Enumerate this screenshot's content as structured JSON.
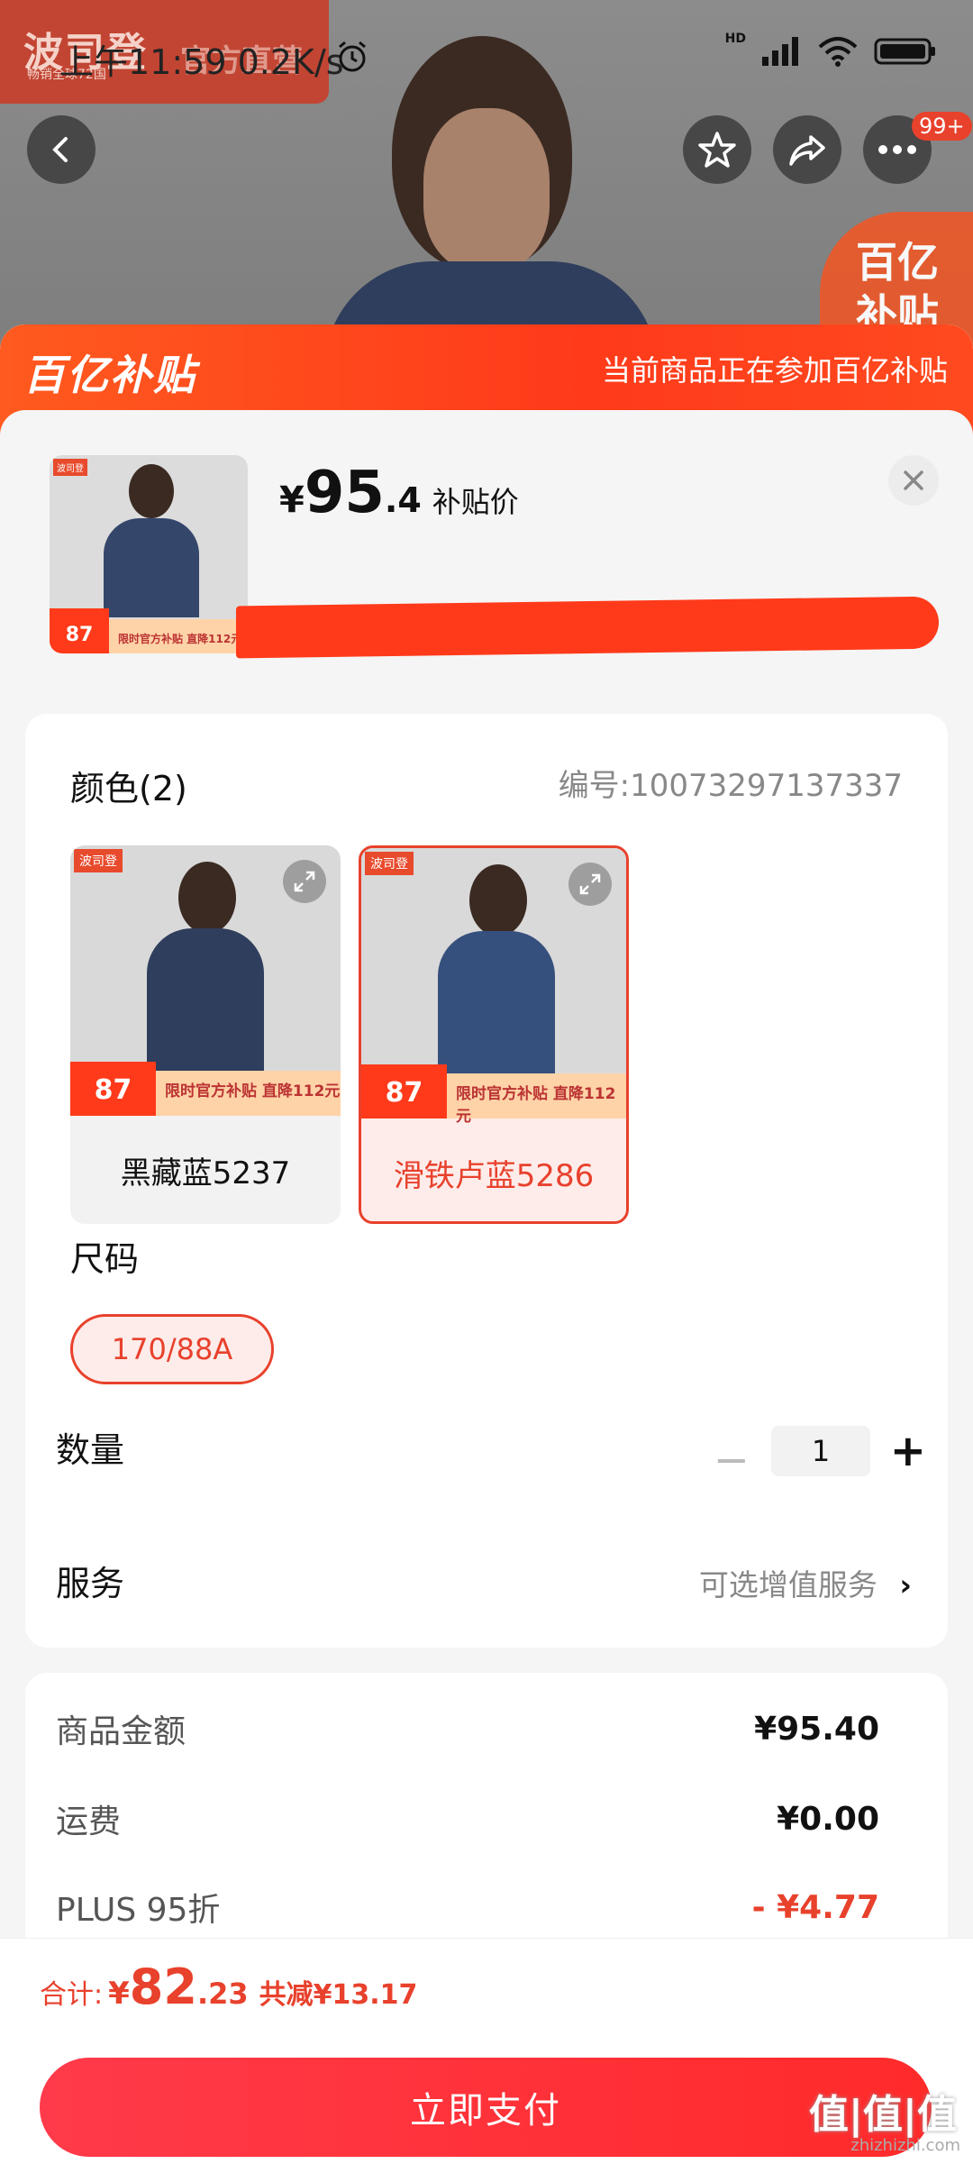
{
  "status_bar": {
    "time": "上午11:59",
    "speed": "0.2K/s",
    "hd": "HD"
  },
  "store": {
    "name": "波司登",
    "sub": "畅销全球72国",
    "official": "官方直营"
  },
  "header": {
    "cart_badge": "99+",
    "corner_tag_line1": "百亿",
    "corner_tag_line2": "补贴"
  },
  "banner": {
    "logo": "百亿补贴",
    "note": "当前商品正在参加百亿补贴"
  },
  "product": {
    "price_yen": "¥",
    "price_int": "95",
    "price_dec": ".4",
    "price_label": "补贴价",
    "thumb_price": "87",
    "thumb_promo": "限时官方补贴 直降112元"
  },
  "options": {
    "color_title": "颜色(2)",
    "serial": "编号:10073297137337",
    "colors": [
      {
        "label": "黑藏蓝5237",
        "price": "87",
        "promo": "限时官方补贴 直降112元",
        "selected": false
      },
      {
        "label": "滑铁卢蓝5286",
        "price": "87",
        "promo": "限时官方补贴 直降112元",
        "selected": true
      }
    ],
    "size_title": "尺码",
    "size_selected": "170/88A",
    "qty_title": "数量",
    "qty_value": "1",
    "service_title": "服务",
    "service_value": "可选增值服务"
  },
  "fees": [
    {
      "label": "商品金额",
      "value": "¥95.40"
    },
    {
      "label": "运费",
      "value": "¥0.00"
    },
    {
      "label": "PLUS 95折",
      "value": "- ¥4.77"
    }
  ],
  "footer": {
    "total_label": "合计:",
    "total_yen": "¥",
    "total_int": "82",
    "total_dec": ".23",
    "saved": "共减¥13.17",
    "pay_label": "立即支付"
  },
  "watermark": {
    "main": "值|值|值",
    "sub": "zhizhizhi.com"
  },
  "colors": {
    "accent": "#e8412c",
    "banner": "#ff4a1f",
    "pay": "#ff2a2a"
  }
}
